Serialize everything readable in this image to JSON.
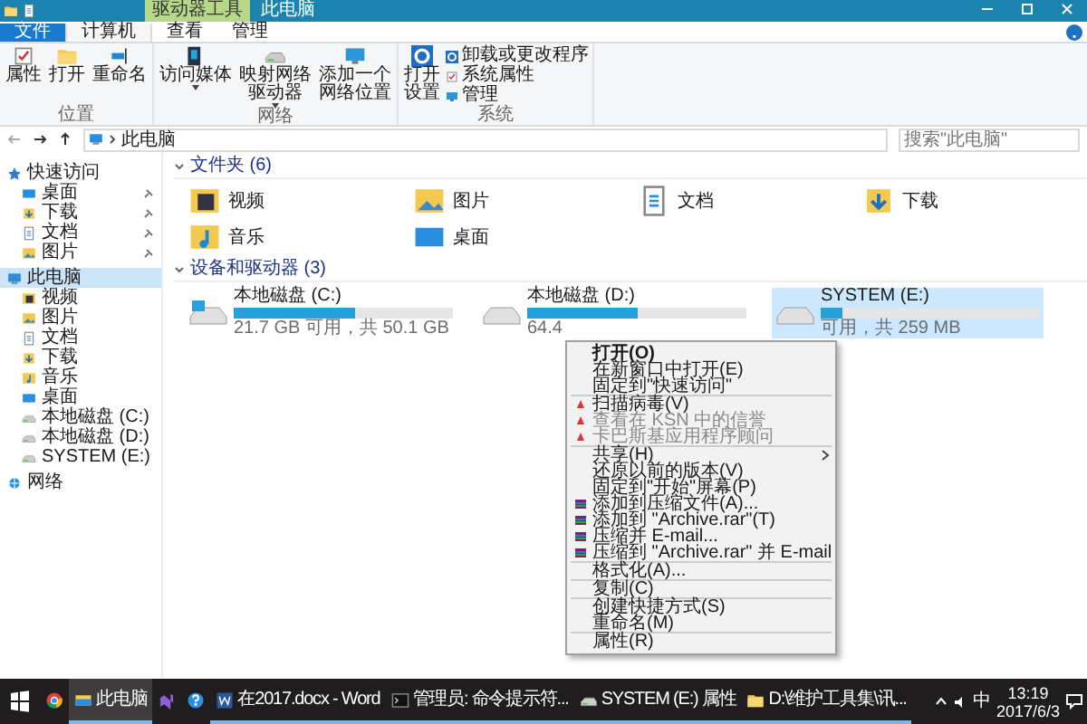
{
  "window": {
    "title": "此电脑",
    "context_tab": "驱动器工具"
  },
  "ribbon_tabs": [
    {
      "label": "文件",
      "kind": "file",
      "selected": false
    },
    {
      "label": "计算机",
      "kind": "tab",
      "selected": true
    },
    {
      "label": "查看",
      "kind": "tab",
      "selected": false
    },
    {
      "label": "管理",
      "kind": "tab",
      "selected": false
    }
  ],
  "ribbon_groups": [
    {
      "label": "位置",
      "buttons": [
        {
          "label": "属性"
        },
        {
          "label": "打开"
        },
        {
          "label": "重命名"
        }
      ]
    },
    {
      "label": "网络",
      "buttons": [
        {
          "label": "访问媒体",
          "dropdown": true
        },
        {
          "label": "映射网络驱动器",
          "dropdown": true
        },
        {
          "label": "添加一个网络位置",
          "dropdown": false
        }
      ]
    },
    {
      "label": "系统",
      "buttons": [
        {
          "label": "打开设置",
          "dropdown": false
        }
      ],
      "small": [
        {
          "label": "卸载或更改程序"
        },
        {
          "label": "系统属性"
        },
        {
          "label": "管理"
        }
      ]
    }
  ],
  "address": {
    "crumb": "此电脑",
    "search_placeholder": "搜索\"此电脑\""
  },
  "sidebar": [
    {
      "label": "快速访问",
      "selected": false,
      "children": [
        {
          "label": "桌面",
          "pinned": true
        },
        {
          "label": "下载",
          "pinned": true
        },
        {
          "label": "文档",
          "pinned": true
        },
        {
          "label": "图片",
          "pinned": true
        }
      ]
    },
    {
      "label": "此电脑",
      "selected": true,
      "children": [
        {
          "label": "视频"
        },
        {
          "label": "图片"
        },
        {
          "label": "文档"
        },
        {
          "label": "下载"
        },
        {
          "label": "音乐"
        },
        {
          "label": "桌面"
        },
        {
          "label": "本地磁盘 (C:)"
        },
        {
          "label": "本地磁盘 (D:)"
        },
        {
          "label": "SYSTEM (E:)"
        }
      ]
    },
    {
      "label": "网络",
      "selected": false
    }
  ],
  "folders": {
    "heading": "文件夹 (6)",
    "items": [
      {
        "label": "视频"
      },
      {
        "label": "图片"
      },
      {
        "label": "文档"
      },
      {
        "label": "下载"
      },
      {
        "label": "音乐"
      },
      {
        "label": "桌面"
      }
    ]
  },
  "drives": {
    "heading": "设备和驱动器 (3)",
    "items": [
      {
        "name": "本地磁盘 (C:)",
        "free": "21.7 GB 可用，共 50.1 GB",
        "level": 0.55,
        "selected": false,
        "windows": true
      },
      {
        "name": "本地磁盘 (D:)",
        "free": "64.4",
        "level": 0.5,
        "selected": false,
        "windows": false
      },
      {
        "name": "SYSTEM (E:)",
        "free": "可用，共 259 MB",
        "level": 0.1,
        "selected": true,
        "windows": false
      }
    ]
  },
  "context_menu": [
    {
      "kind": "item",
      "label": "打开(O)",
      "bold": true
    },
    {
      "kind": "item",
      "label": "在新窗口中打开(E)"
    },
    {
      "kind": "item",
      "label": "固定到\"快速访问\""
    },
    {
      "kind": "separator"
    },
    {
      "kind": "av_item",
      "label": "扫描病毒(V)"
    },
    {
      "kind": "av_item",
      "label": "查看在 KSN 中的信誉",
      "disabled": true
    },
    {
      "kind": "av_item",
      "label": "卡巴斯基应用程序顾问",
      "disabled": true
    },
    {
      "kind": "separator"
    },
    {
      "kind": "submenu",
      "label": "共享(H)"
    },
    {
      "kind": "item",
      "label": "还原以前的版本(V)"
    },
    {
      "kind": "item",
      "label": "固定到\"开始\"屏幕(P)"
    },
    {
      "kind": "archive_item",
      "label": "添加到压缩文件(A)..."
    },
    {
      "kind": "archive_item",
      "label": "添加到 \"Archive.rar\"(T)"
    },
    {
      "kind": "archive_item",
      "label": "压缩并 E-mail..."
    },
    {
      "kind": "archive_item",
      "label": "压缩到 \"Archive.rar\" 并 E-mail"
    },
    {
      "kind": "separator"
    },
    {
      "kind": "item",
      "label": "格式化(A)..."
    },
    {
      "kind": "separator"
    },
    {
      "kind": "item",
      "label": "复制(C)"
    },
    {
      "kind": "separator"
    },
    {
      "kind": "item",
      "label": "创建快捷方式(S)"
    },
    {
      "kind": "item",
      "label": "重命名(M)"
    },
    {
      "kind": "separator"
    },
    {
      "kind": "item",
      "label": "属性(R)"
    }
  ],
  "taskbar": {
    "apps": [
      {
        "kind": "icon",
        "selected": false
      },
      {
        "kind": "app",
        "label": "此电脑",
        "selected": true
      },
      {
        "kind": "icon",
        "selected": false
      },
      {
        "kind": "icon",
        "selected": false
      },
      {
        "kind": "app",
        "label": "在2017.docx - Word",
        "selected": false
      },
      {
        "kind": "app",
        "label": "管理员: 命令提示符...",
        "selected": false
      },
      {
        "kind": "app",
        "label": "SYSTEM (E:) 属性",
        "selected": false
      },
      {
        "kind": "app",
        "label": "D:\\维护工具集\\讯...",
        "selected": false
      }
    ],
    "ime": "中",
    "time": "13:19",
    "date": "2017/6/3"
  }
}
